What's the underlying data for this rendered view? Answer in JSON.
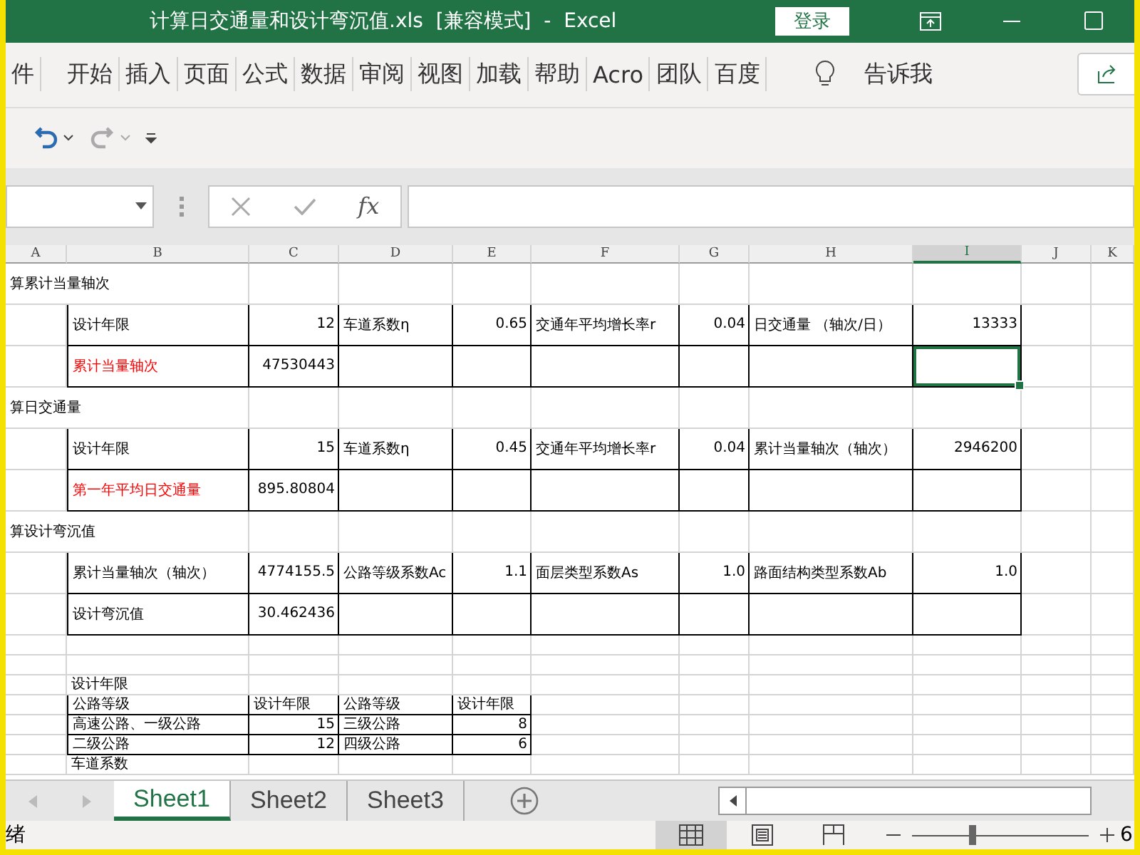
{
  "window": {
    "title": "计算日交通量和设计弯沉值.xls  [兼容模式]  -  Excel",
    "sign_in": "登录"
  },
  "ribbon_tabs": [
    {
      "label": "件",
      "selected": false
    },
    {
      "label": "开始",
      "selected": false
    },
    {
      "label": "插入",
      "selected": false
    },
    {
      "label": "页面",
      "selected": false
    },
    {
      "label": "公式",
      "selected": false
    },
    {
      "label": "数据",
      "selected": false
    },
    {
      "label": "审阅",
      "selected": false
    },
    {
      "label": "视图",
      "selected": false
    },
    {
      "label": "加载",
      "selected": false
    },
    {
      "label": "帮助",
      "selected": false
    },
    {
      "label": "Acro",
      "selected": false
    },
    {
      "label": "团队",
      "selected": false
    },
    {
      "label": "百度",
      "selected": false
    }
  ],
  "tell_me": "告诉我",
  "quick_access": {
    "undo_disabled": false,
    "redo_disabled": true
  },
  "formula_bar": {
    "function_label": "fx"
  },
  "columns": [
    {
      "label": "A",
      "selected": false
    },
    {
      "label": "B",
      "selected": false
    },
    {
      "label": "C",
      "selected": false
    },
    {
      "label": "D",
      "selected": false
    },
    {
      "label": "E",
      "selected": false
    },
    {
      "label": "F",
      "selected": false
    },
    {
      "label": "G",
      "selected": false
    },
    {
      "label": "H",
      "selected": false
    },
    {
      "label": "I",
      "selected": true
    },
    {
      "label": "J",
      "selected": false
    },
    {
      "label": "K",
      "selected": false
    }
  ],
  "rows": [
    {
      "kind": "heading",
      "cells": [
        {
          "text": "算累计当量轴次",
          "kind": "text",
          "selected": false
        }
      ]
    },
    {
      "kind": "data",
      "cells": [
        {
          "selected": false
        },
        {
          "text": "设计年限",
          "kind": "text",
          "selected": false
        },
        {
          "text": "12",
          "kind": "number",
          "selected": false
        },
        {
          "text": "车道系数η",
          "kind": "text",
          "selected": false
        },
        {
          "text": "0.65",
          "kind": "number",
          "selected": false
        },
        {
          "text": "交通年平均增长率r",
          "kind": "text",
          "selected": false
        },
        {
          "text": "0.04",
          "kind": "number",
          "selected": false
        },
        {
          "text": "日交通量 （轴次/日）",
          "kind": "text",
          "selected": false
        },
        {
          "text": "13333",
          "kind": "number",
          "selected": false
        }
      ]
    },
    {
      "kind": "data",
      "cells": [
        {
          "selected": false
        },
        {
          "text": "累计当量轴次",
          "kind": "text",
          "color": "#ff0000",
          "selected": false
        },
        {
          "text": "47530443",
          "kind": "number",
          "selected": false
        },
        {
          "selected": false
        },
        {
          "selected": false
        },
        {
          "selected": false
        },
        {
          "selected": false
        },
        {
          "selected": false
        },
        {
          "selected": true
        }
      ]
    },
    {
      "kind": "heading",
      "cells": [
        {
          "text": "算日交通量",
          "kind": "text",
          "selected": false
        }
      ]
    },
    {
      "kind": "data",
      "cells": [
        {
          "selected": false
        },
        {
          "text": "设计年限",
          "kind": "text",
          "selected": false
        },
        {
          "text": "15",
          "kind": "number",
          "selected": false
        },
        {
          "text": "车道系数η",
          "kind": "text",
          "selected": false
        },
        {
          "text": "0.45",
          "kind": "number",
          "selected": false
        },
        {
          "text": "交通年平均增长率r",
          "kind": "text",
          "selected": false
        },
        {
          "text": "0.04",
          "kind": "number",
          "selected": false
        },
        {
          "text": "累计当量轴次（轴次）",
          "kind": "text",
          "selected": false
        },
        {
          "text": "2946200",
          "kind": "number",
          "selected": false
        }
      ]
    },
    {
      "kind": "data",
      "cells": [
        {
          "selected": false
        },
        {
          "text": "第一年平均日交通量",
          "kind": "text",
          "color": "#ff0000",
          "selected": false
        },
        {
          "text": "895.80804",
          "kind": "number",
          "selected": false
        }
      ]
    },
    {
      "kind": "heading",
      "cells": [
        {
          "text": "算设计弯沉值",
          "kind": "text",
          "selected": false
        }
      ]
    },
    {
      "kind": "data",
      "cells": [
        {
          "selected": false
        },
        {
          "text": "累计当量轴次（轴次）",
          "kind": "text",
          "selected": false
        },
        {
          "text": "4774155.5",
          "kind": "number",
          "selected": false
        },
        {
          "text": "公路等级系数Ac",
          "kind": "text",
          "selected": false
        },
        {
          "text": "1.1",
          "kind": "number",
          "selected": false
        },
        {
          "text": "面层类型系数As",
          "kind": "text",
          "selected": false
        },
        {
          "text": "1.0",
          "kind": "number",
          "selected": false
        },
        {
          "text": "路面结构类型系数Ab",
          "kind": "text",
          "selected": false
        },
        {
          "text": "1.0",
          "kind": "number",
          "selected": false
        }
      ]
    },
    {
      "kind": "data",
      "cells": [
        {
          "selected": false
        },
        {
          "text": "设计弯沉值",
          "kind": "text",
          "selected": false
        },
        {
          "text": "30.462436",
          "kind": "number",
          "selected": false
        }
      ]
    },
    {
      "kind": "blank",
      "cells": []
    },
    {
      "kind": "blank",
      "cells": []
    },
    {
      "kind": "plain",
      "cells": [
        {
          "selected": false
        },
        {
          "text": "设计年限",
          "kind": "text",
          "selected": false
        }
      ]
    },
    {
      "kind": "table",
      "cells": [
        {
          "selected": false
        },
        {
          "text": "公路等级",
          "kind": "text",
          "selected": false
        },
        {
          "text": "设计年限",
          "kind": "text",
          "selected": false
        },
        {
          "text": "公路等级",
          "kind": "text",
          "selected": false
        },
        {
          "text": "设计年限",
          "kind": "text",
          "selected": false
        }
      ]
    },
    {
      "kind": "table",
      "cells": [
        {
          "selected": false
        },
        {
          "text": "高速公路、一级公路",
          "kind": "text",
          "selected": false
        },
        {
          "text": "15",
          "kind": "number",
          "selected": false
        },
        {
          "text": "三级公路",
          "kind": "text",
          "selected": false
        },
        {
          "text": "8",
          "kind": "number",
          "selected": false
        }
      ]
    },
    {
      "kind": "table",
      "cells": [
        {
          "selected": false
        },
        {
          "text": "二级公路",
          "kind": "text",
          "selected": false
        },
        {
          "text": "12",
          "kind": "number",
          "selected": false
        },
        {
          "text": "四级公路",
          "kind": "text",
          "selected": false
        },
        {
          "text": "6",
          "kind": "number",
          "selected": false
        }
      ]
    },
    {
      "kind": "plain",
      "cells": [
        {
          "selected": false
        },
        {
          "text": "车道系数",
          "kind": "text",
          "selected": false
        }
      ]
    }
  ],
  "sheet_tabs": [
    {
      "label": "Sheet1",
      "selected": true
    },
    {
      "label": "Sheet2",
      "selected": false
    },
    {
      "label": "Sheet3",
      "selected": false
    }
  ],
  "status_bar": {
    "status": "绪",
    "views": [
      {
        "kind": "normal",
        "selected": true
      },
      {
        "kind": "page",
        "selected": false
      },
      {
        "kind": "break",
        "selected": false
      }
    ],
    "zoom": {
      "level": 0.33,
      "reading": "6"
    }
  }
}
